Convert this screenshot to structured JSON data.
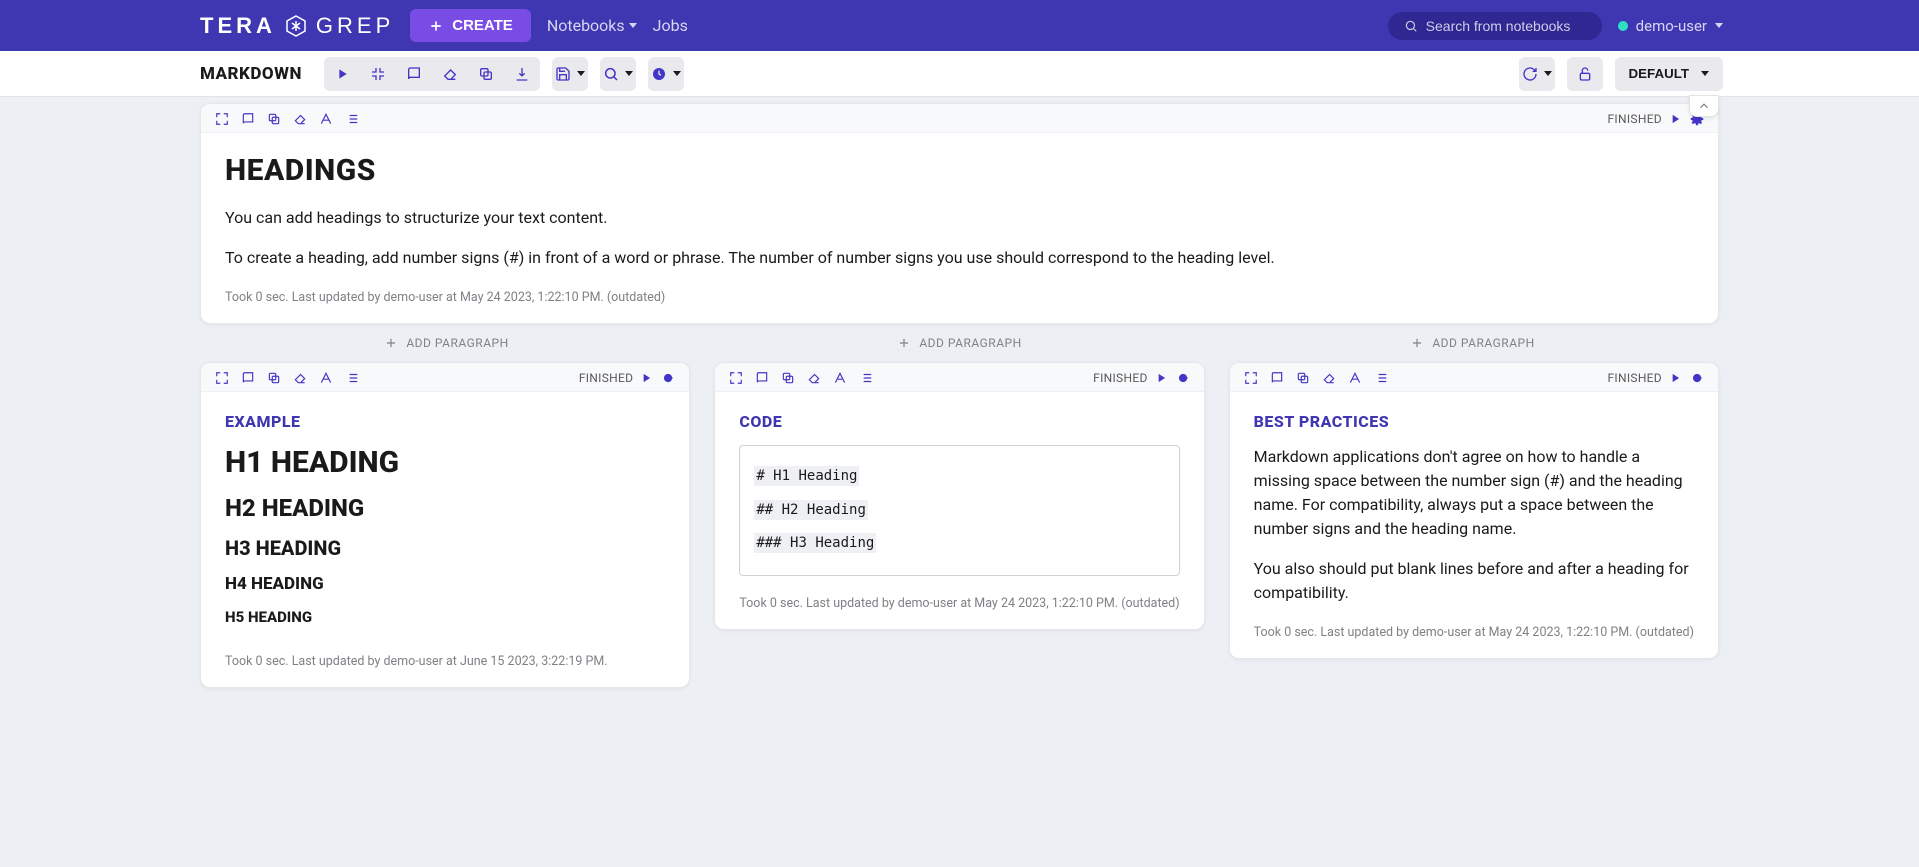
{
  "brand": {
    "a": "TERA",
    "b": "GREP"
  },
  "nav": {
    "create": "CREATE",
    "notebooks": "Notebooks",
    "jobs": "Jobs",
    "search_ph": "Search from notebooks",
    "user": "demo-user"
  },
  "toolbar": {
    "title": "MARKDOWN",
    "default_btn": "DEFAULT"
  },
  "labels": {
    "add_paragraph": "ADD PARAGRAPH",
    "finished": "FINISHED"
  },
  "cells": {
    "main": {
      "title": "HEADINGS",
      "p1": "You can add headings to structurize your text content.",
      "p2": "To create a heading, add number signs (#) in front of a word or phrase. The number of number signs you use should correspond to the heading level.",
      "footer": "Took 0 sec. Last updated by demo-user at May 24 2023, 1:22:10 PM. (outdated)"
    },
    "example": {
      "title": "EXAMPLE",
      "h1": "H1 HEADING",
      "h2": "H2 HEADING",
      "h3": "H3 HEADING",
      "h4": "H4 HEADING",
      "h5": "H5 HEADING",
      "footer": "Took 0 sec. Last updated by demo-user at June 15 2023, 3:22:19 PM."
    },
    "code": {
      "title": "CODE",
      "l1": "# H1 Heading",
      "l2": "## H2 Heading",
      "l3": "### H3 Heading",
      "footer": "Took 0 sec. Last updated by demo-user at May 24 2023, 1:22:10 PM. (outdated)"
    },
    "best": {
      "title": "BEST PRACTICES",
      "p1": "Markdown applications don't agree on how to handle a missing space between the number sign (#) and the heading name. For compatibility, always put a space between the number signs and the heading name.",
      "p2": "You also should put blank lines before and after a heading for compatibility.",
      "footer": "Took 0 sec. Last updated by demo-user at May 24 2023, 1:22:10 PM. (outdated)"
    }
  }
}
